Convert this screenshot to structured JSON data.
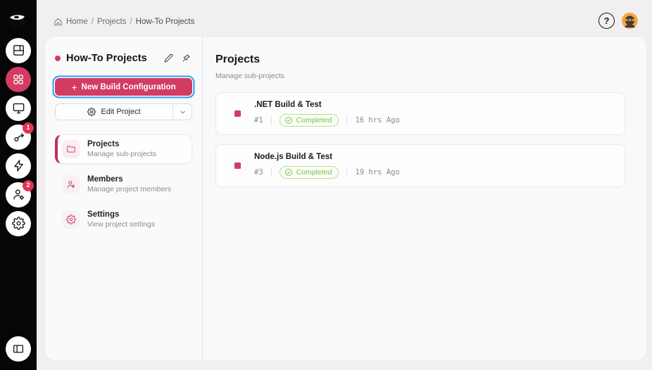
{
  "colors": {
    "accent_crimson": "#d23c63",
    "focus_blue": "#2b9bf2",
    "success_green": "#76c043",
    "rail_black": "#060606",
    "avatar_orange": "#f2a93b"
  },
  "breadcrumb": {
    "items": [
      "Home",
      "Projects",
      "How-To Projects"
    ],
    "separator": "/"
  },
  "topbar": {
    "help_glyph": "?"
  },
  "rail": {
    "items": [
      {
        "name": "dashboard"
      },
      {
        "name": "projects-grid",
        "active": true
      },
      {
        "name": "monitor"
      },
      {
        "name": "pipelines",
        "badge": "1"
      },
      {
        "name": "agents"
      },
      {
        "name": "users",
        "badge": "2"
      },
      {
        "name": "settings"
      }
    ],
    "bottom_item": {
      "name": "collapse-sidebar"
    }
  },
  "project_panel": {
    "title": "How-To Projects",
    "new_build": {
      "plus": "+",
      "label": "New Build Configuration"
    },
    "edit_project_label": "Edit Project",
    "nav": [
      {
        "label": "Projects",
        "sublabel": "Manage sub-projects",
        "active": true
      },
      {
        "label": "Members",
        "sublabel": "Manage project members",
        "active": false
      },
      {
        "label": "Settings",
        "sublabel": "View project settings",
        "active": false
      }
    ]
  },
  "main": {
    "title": "Projects",
    "subtitle": "Manage sub-projects",
    "cards": [
      {
        "title": ".NET Build & Test",
        "build_number": "#1",
        "status": "Completed",
        "time": "16 hrs Ago"
      },
      {
        "title": "Node.js Build & Test",
        "build_number": "#3",
        "status": "Completed",
        "time": "19 hrs Ago"
      }
    ]
  }
}
